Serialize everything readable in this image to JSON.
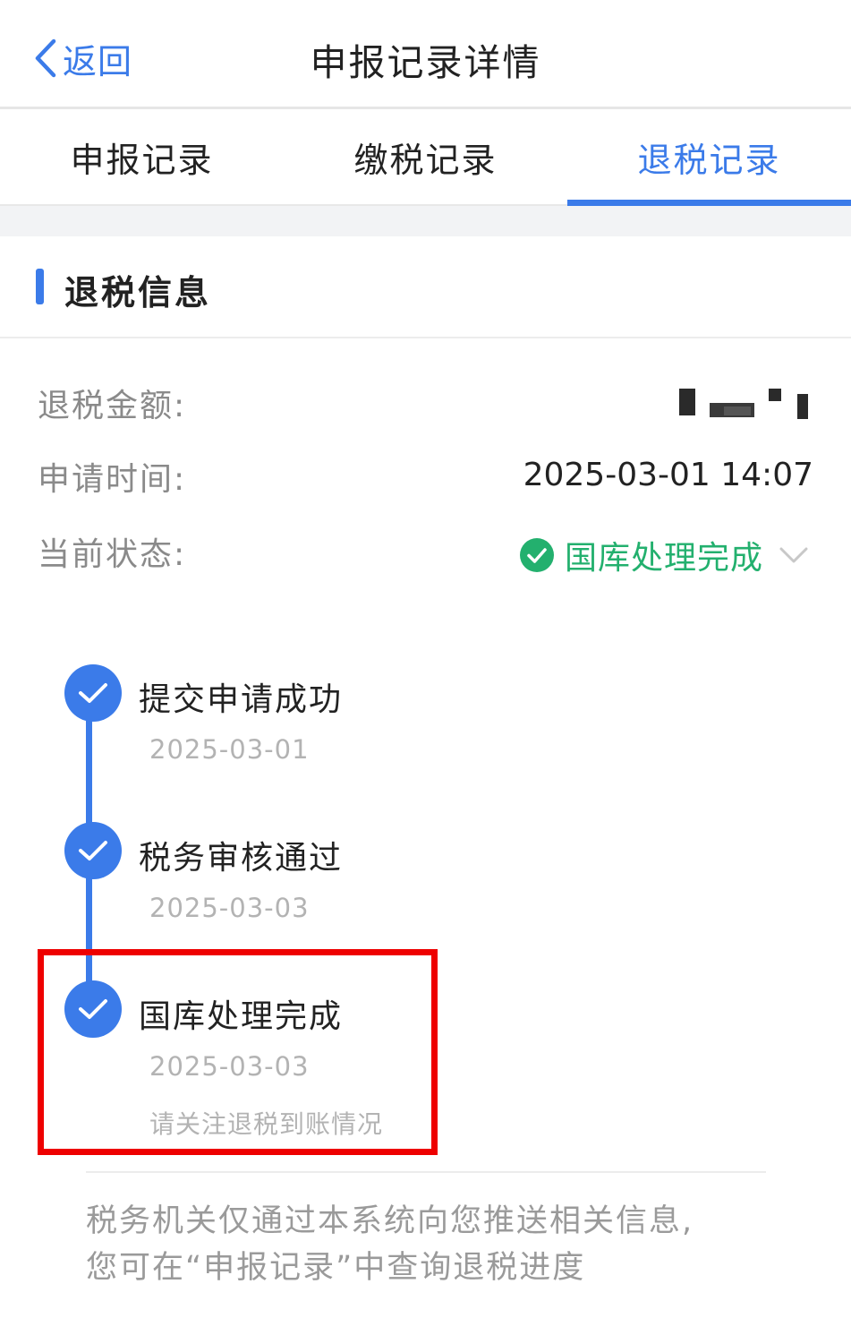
{
  "header": {
    "back_label": "返回",
    "title": "申报记录详情"
  },
  "tabs": [
    {
      "label": "申报记录",
      "active": false
    },
    {
      "label": "缴税记录",
      "active": false
    },
    {
      "label": "退税记录",
      "active": true
    }
  ],
  "section": {
    "title": "退税信息"
  },
  "info": {
    "amount_label": "退税金额:",
    "apply_time_label": "申请时间:",
    "apply_time_value": "2025-03-01 14:07",
    "status_label": "当前状态:",
    "status_value": "国库处理完成"
  },
  "timeline": [
    {
      "title": "提交申请成功",
      "date": "2025-03-01"
    },
    {
      "title": "税务审核通过",
      "date": "2025-03-03"
    },
    {
      "title": "国库处理完成",
      "date": "2025-03-03",
      "note": "请关注退税到账情况"
    }
  ],
  "footer": {
    "line1": "税务机关仅通过本系统向您推送相关信息,",
    "line2": "您可在“申报记录”中查询退税进度"
  },
  "colors": {
    "accent": "#3b7be9",
    "success": "#23b06e",
    "highlight": "#ee0000"
  }
}
